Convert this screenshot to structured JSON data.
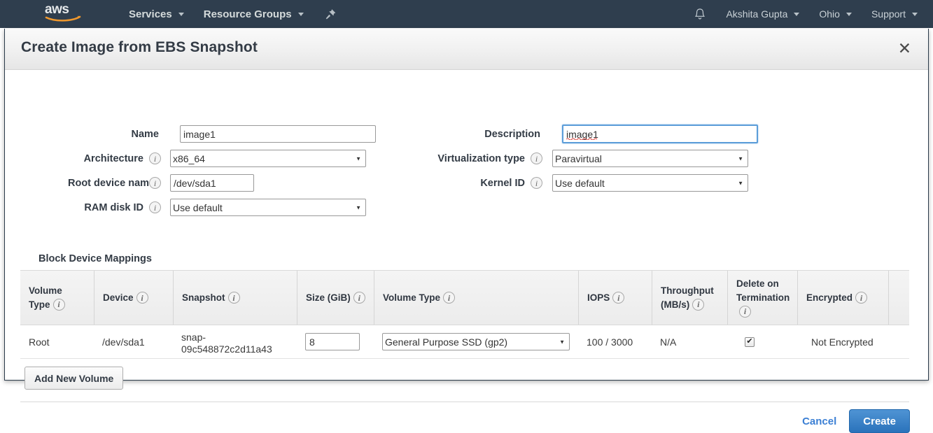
{
  "navbar": {
    "logo": "aws-logo",
    "left_items": [
      {
        "label": "Services",
        "icon": "chevron-down-icon"
      },
      {
        "label": "Resource Groups",
        "icon": "chevron-down-icon"
      }
    ],
    "pin_icon": "pushpin-icon",
    "bell_icon": "bell-icon",
    "right_items": [
      {
        "label": "Akshita Gupta",
        "icon": "chevron-down-icon"
      },
      {
        "label": "Ohio",
        "icon": "chevron-down-icon"
      },
      {
        "label": "Support",
        "icon": "chevron-down-icon"
      }
    ]
  },
  "modal": {
    "title": "Create Image from EBS Snapshot",
    "close_label": "✕",
    "form": {
      "name": {
        "label": "Name",
        "value": "image1"
      },
      "description": {
        "label": "Description",
        "value": "image1"
      },
      "architecture": {
        "label": "Architecture",
        "value": "x86_64"
      },
      "virtualization_type": {
        "label": "Virtualization type",
        "value": "Paravirtual"
      },
      "root_device_name": {
        "label": "Root device name",
        "value": "/dev/sda1"
      },
      "kernel_id": {
        "label": "Kernel ID",
        "value": "Use default"
      },
      "ram_disk_id": {
        "label": "RAM disk ID",
        "value": "Use default"
      }
    },
    "block_device_mappings": {
      "section_title": "Block Device Mappings",
      "columns": [
        {
          "label": "Volume Type",
          "has_info": true
        },
        {
          "label": "Device",
          "has_info": true
        },
        {
          "label": "Snapshot",
          "has_info": true
        },
        {
          "label": "Size (GiB)",
          "has_info": true
        },
        {
          "label": "Volume Type",
          "has_info": true
        },
        {
          "label": "IOPS",
          "has_info": true
        },
        {
          "label": "Throughput (MB/s)",
          "has_info": true
        },
        {
          "label": "Delete on Termination",
          "has_info": true
        },
        {
          "label": "Encrypted",
          "has_info": true
        },
        {
          "label": "",
          "has_info": false
        }
      ],
      "rows": [
        {
          "volume_type": "Root",
          "device": "/dev/sda1",
          "snapshot": "snap-09c548872c2d11a43",
          "size": "8",
          "volume_type_select": "General Purpose SSD (gp2)",
          "iops": "100 / 3000",
          "throughput": "N/A",
          "delete_on_termination": true,
          "delete_checkmark": "✔",
          "encrypted": "Not Encrypted"
        }
      ]
    },
    "add_volume_label": "Add New Volume",
    "cancel_label": "Cancel",
    "create_label": "Create"
  },
  "colors": {
    "nav_bg": "#2f3e4e",
    "aws_orange": "#ec912d",
    "primary_button": "#2a72bb",
    "link_blue": "#3b7fd4",
    "focus_border": "#5b9dd9"
  }
}
